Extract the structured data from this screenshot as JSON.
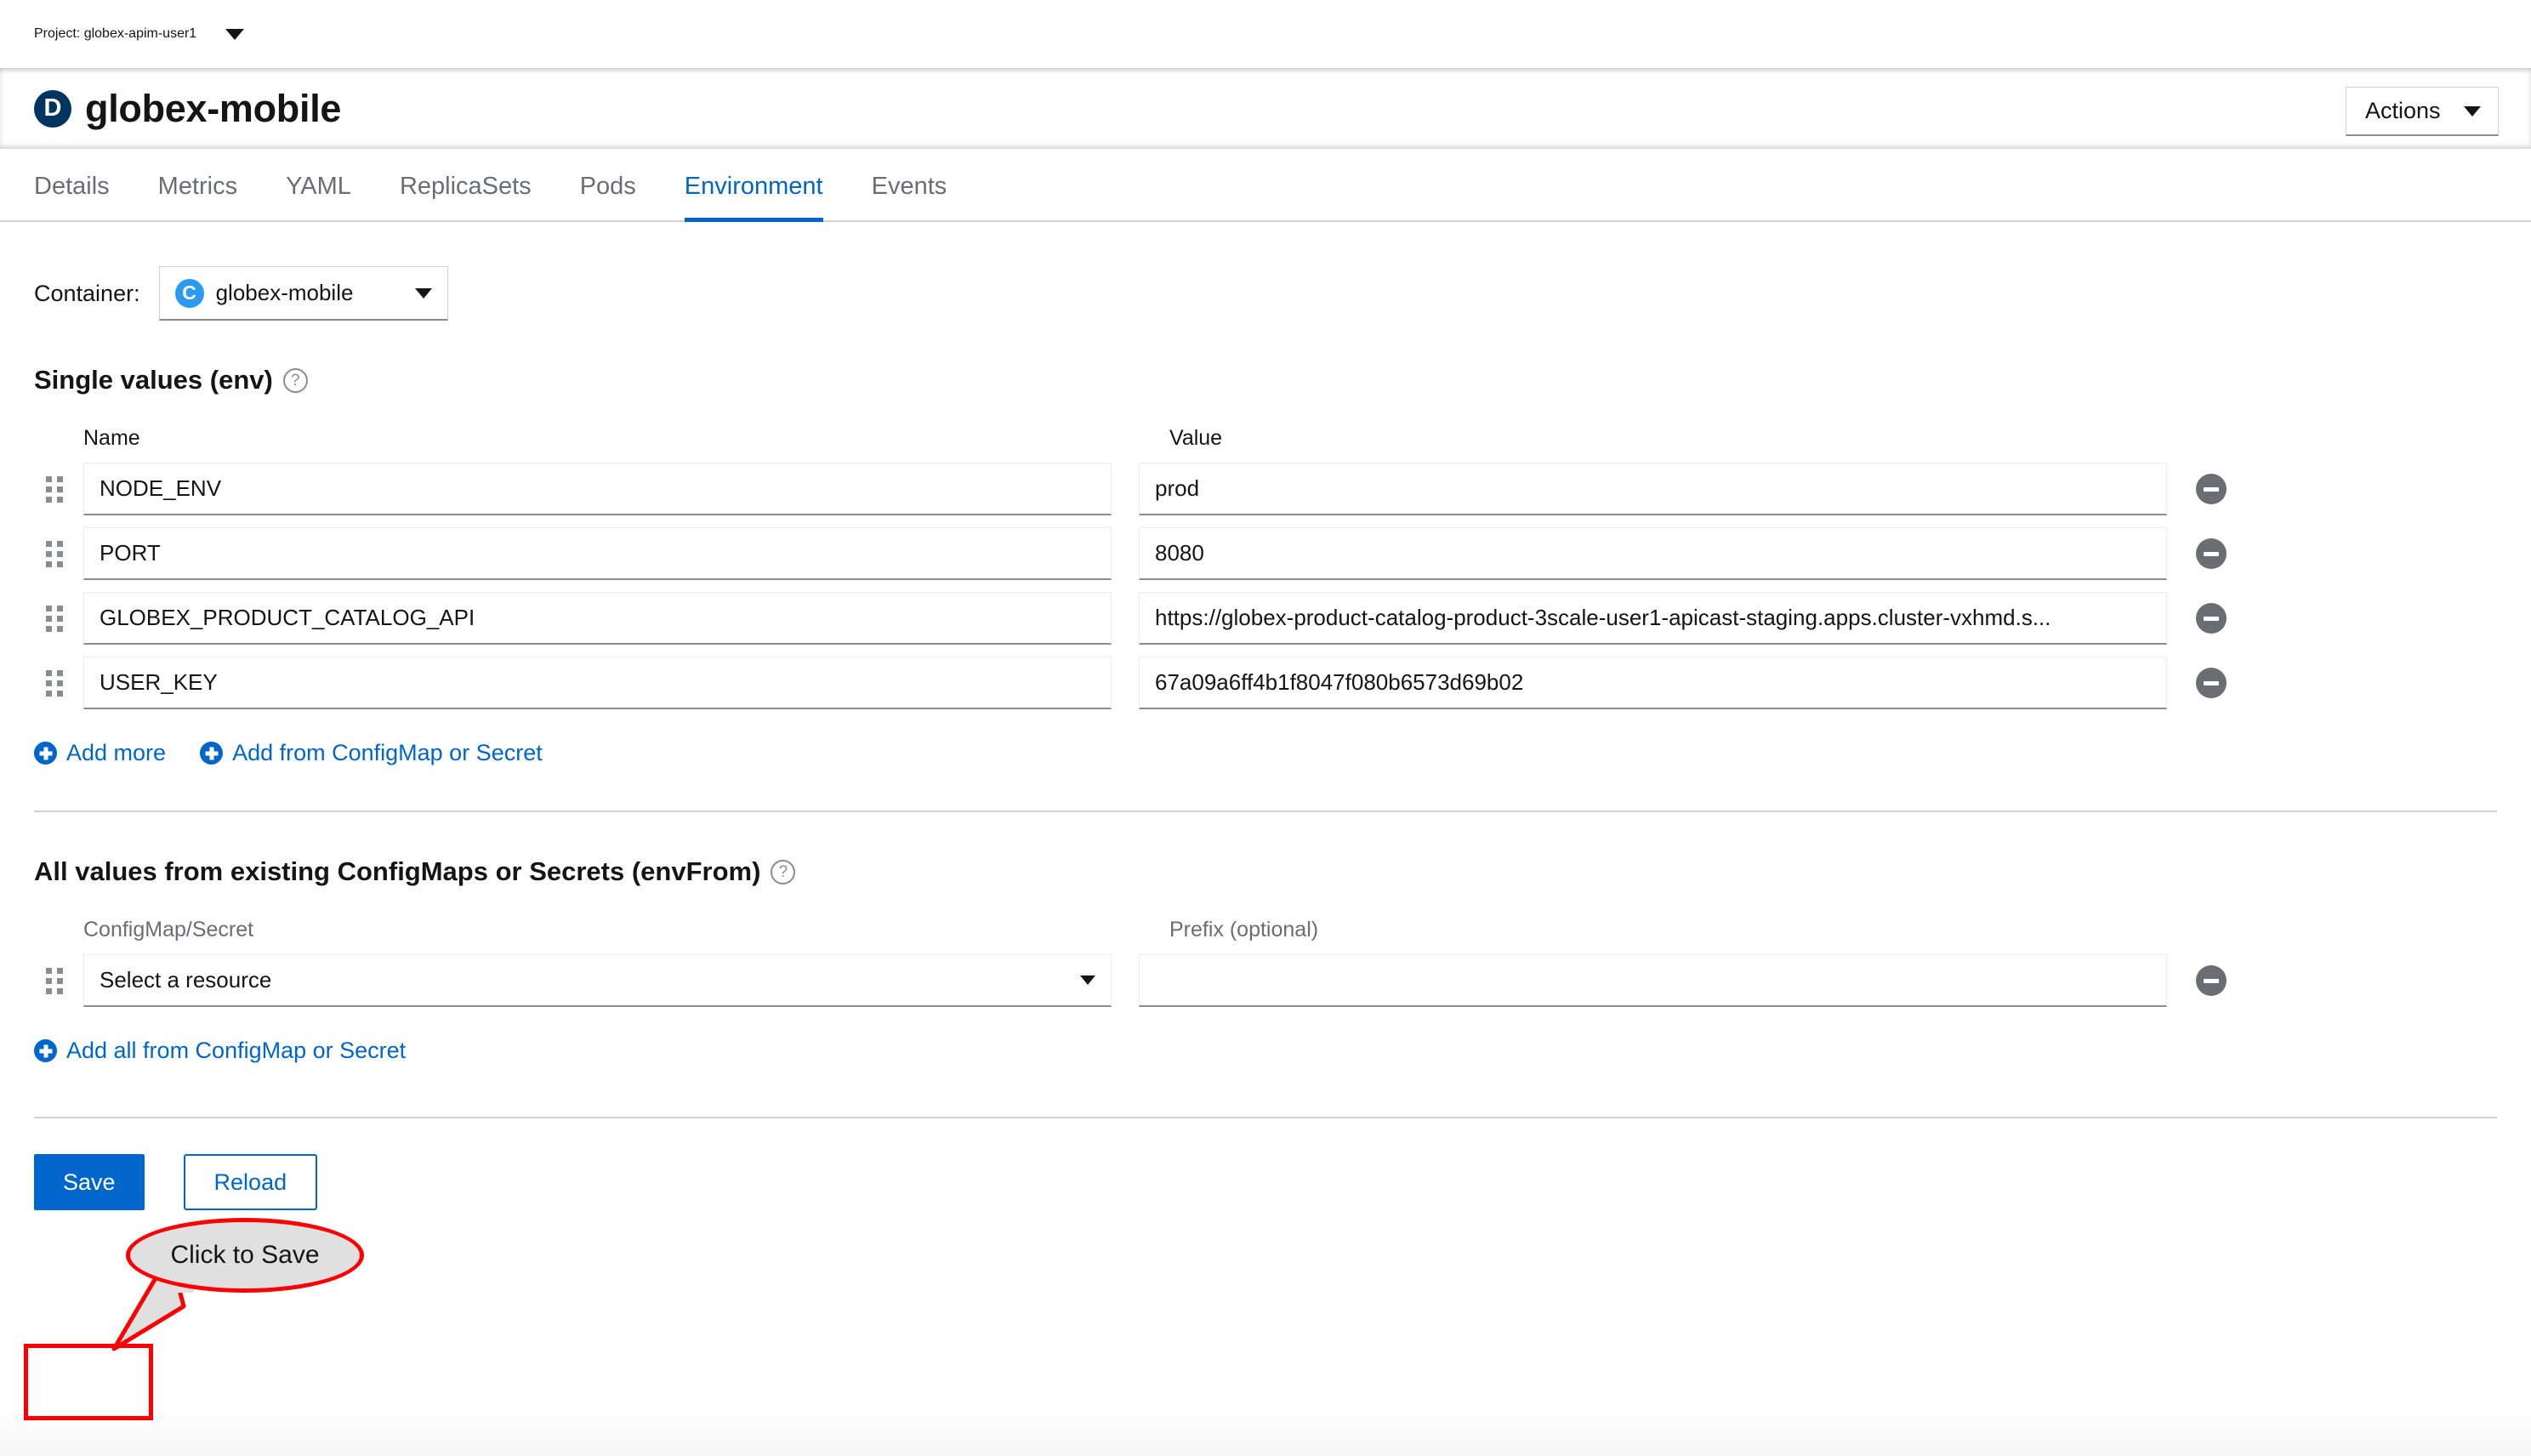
{
  "project_bar": {
    "label": "Project: globex-apim-user1",
    "caret_icon": "chevron-down-icon"
  },
  "header": {
    "badge_letter": "D",
    "badge_color": "#00355f",
    "title": "globex-mobile",
    "actions_label": "Actions",
    "actions_caret_icon": "chevron-down-icon"
  },
  "tabs": [
    {
      "label": "Details",
      "active": false
    },
    {
      "label": "Metrics",
      "active": false
    },
    {
      "label": "YAML",
      "active": false
    },
    {
      "label": "ReplicaSets",
      "active": false
    },
    {
      "label": "Pods",
      "active": false
    },
    {
      "label": "Environment",
      "active": true
    },
    {
      "label": "Events",
      "active": false
    }
  ],
  "container": {
    "label": "Container:",
    "badge_letter": "C",
    "badge_color": "#2b9af3",
    "selected": "globex-mobile",
    "caret_icon": "chevron-down-icon"
  },
  "env_section": {
    "title": "Single values (env)",
    "help_icon": "question-circle-icon",
    "col_name": "Name",
    "col_value": "Value",
    "rows": [
      {
        "name": "NODE_ENV",
        "value": "prod"
      },
      {
        "name": "PORT",
        "value": "8080"
      },
      {
        "name": "GLOBEX_PRODUCT_CATALOG_API",
        "value": "https://globex-product-catalog-product-3scale-user1-apicast-staging.apps.cluster-vxhmd.s..."
      },
      {
        "name": "USER_KEY",
        "value": "67a09a6ff4b1f8047f080b6573d69b02"
      }
    ],
    "add_more_label": "Add more",
    "add_from_cm_label": "Add from ConfigMap or Secret"
  },
  "envfrom_section": {
    "title": "All values from existing ConfigMaps or Secrets (envFrom)",
    "help_icon": "question-circle-icon",
    "col_resource": "ConfigMap/Secret",
    "col_prefix": "Prefix (optional)",
    "resource_selected": "Select a resource",
    "prefix_value": "",
    "prefix_placeholder": "",
    "add_all_label": "Add all from ConfigMap or Secret"
  },
  "footer": {
    "save_label": "Save",
    "reload_label": "Reload"
  },
  "annotation": {
    "callout_text": "Click to Save",
    "highlight_color": "#ff0000",
    "bubble_fill": "#e0e0e0"
  }
}
